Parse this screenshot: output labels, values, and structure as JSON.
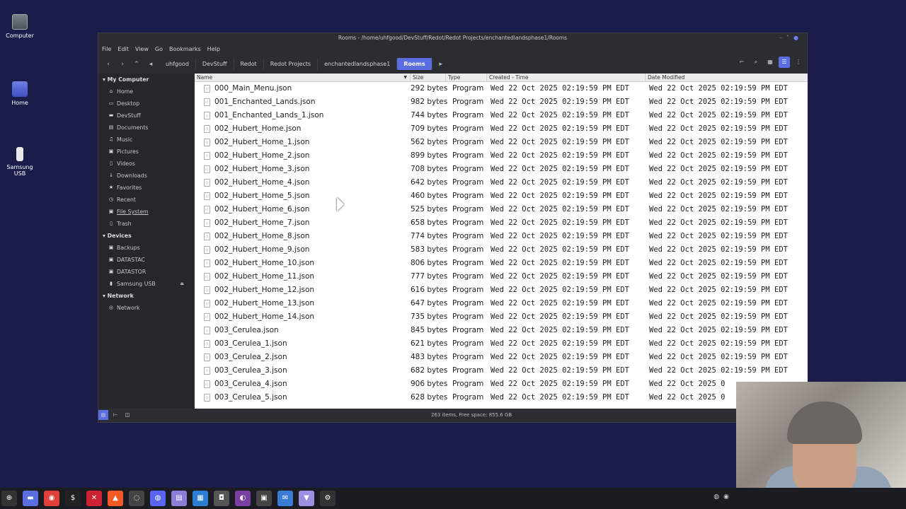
{
  "desktop": {
    "icons": [
      {
        "label": "Computer"
      },
      {
        "label": "Home"
      },
      {
        "label": "Samsung USB"
      }
    ]
  },
  "window": {
    "title": "Rooms - /home/uhfgood/DevStuff/Redot/Redot Projects/enchantedlandsphase1/Rooms",
    "menu": [
      "File",
      "Edit",
      "View",
      "Go",
      "Bookmarks",
      "Help"
    ],
    "breadcrumbs": [
      "uhfgood",
      "DevStuff",
      "Redot",
      "Redot Projects",
      "enchantedlandsphase1",
      "Rooms"
    ],
    "status": "263 items, Free space: 855.6 GB"
  },
  "sidebar": {
    "sections": [
      {
        "title": "My Computer",
        "items": [
          {
            "label": "Home",
            "icon": "home-icon"
          },
          {
            "label": "Desktop",
            "icon": "desktop-icon"
          },
          {
            "label": "DevStuff",
            "icon": "folder-icon"
          },
          {
            "label": "Documents",
            "icon": "documents-icon"
          },
          {
            "label": "Music",
            "icon": "music-icon"
          },
          {
            "label": "Pictures",
            "icon": "pictures-icon"
          },
          {
            "label": "Videos",
            "icon": "videos-icon"
          },
          {
            "label": "Downloads",
            "icon": "downloads-icon"
          },
          {
            "label": "Favorites",
            "icon": "star-icon"
          },
          {
            "label": "Recent",
            "icon": "clock-icon"
          },
          {
            "label": "File System",
            "icon": "drive-icon"
          },
          {
            "label": "Trash",
            "icon": "trash-icon"
          }
        ]
      },
      {
        "title": "Devices",
        "items": [
          {
            "label": "Backups",
            "icon": "drive-icon"
          },
          {
            "label": "DATASTAC",
            "icon": "drive-icon"
          },
          {
            "label": "DATASTOR",
            "icon": "drive-icon"
          },
          {
            "label": "Samsung USB",
            "icon": "usb-icon"
          }
        ]
      },
      {
        "title": "Network",
        "items": [
          {
            "label": "Network",
            "icon": "network-icon"
          }
        ]
      }
    ]
  },
  "columns": {
    "name": "Name",
    "size": "Size",
    "type": "Type",
    "created": "Created - Time",
    "modified": "Date Modified"
  },
  "files": [
    {
      "name": "000_Main_Menu.json",
      "size": "292 bytes",
      "type": "Program",
      "created": "Wed 22 Oct 2025 02:19:59 PM EDT",
      "modified": "Wed 22 Oct 2025 02:19:59 PM EDT"
    },
    {
      "name": "001_Enchanted_Lands.json",
      "size": "982 bytes",
      "type": "Program",
      "created": "Wed 22 Oct 2025 02:19:59 PM EDT",
      "modified": "Wed 22 Oct 2025 02:19:59 PM EDT"
    },
    {
      "name": "001_Enchanted_Lands_1.json",
      "size": "744 bytes",
      "type": "Program",
      "created": "Wed 22 Oct 2025 02:19:59 PM EDT",
      "modified": "Wed 22 Oct 2025 02:19:59 PM EDT"
    },
    {
      "name": "002_Hubert_Home.json",
      "size": "709 bytes",
      "type": "Program",
      "created": "Wed 22 Oct 2025 02:19:59 PM EDT",
      "modified": "Wed 22 Oct 2025 02:19:59 PM EDT"
    },
    {
      "name": "002_Hubert_Home_1.json",
      "size": "562 bytes",
      "type": "Program",
      "created": "Wed 22 Oct 2025 02:19:59 PM EDT",
      "modified": "Wed 22 Oct 2025 02:19:59 PM EDT"
    },
    {
      "name": "002_Hubert_Home_2.json",
      "size": "899 bytes",
      "type": "Program",
      "created": "Wed 22 Oct 2025 02:19:59 PM EDT",
      "modified": "Wed 22 Oct 2025 02:19:59 PM EDT"
    },
    {
      "name": "002_Hubert_Home_3.json",
      "size": "708 bytes",
      "type": "Program",
      "created": "Wed 22 Oct 2025 02:19:59 PM EDT",
      "modified": "Wed 22 Oct 2025 02:19:59 PM EDT"
    },
    {
      "name": "002_Hubert_Home_4.json",
      "size": "642 bytes",
      "type": "Program",
      "created": "Wed 22 Oct 2025 02:19:59 PM EDT",
      "modified": "Wed 22 Oct 2025 02:19:59 PM EDT"
    },
    {
      "name": "002_Hubert_Home_5.json",
      "size": "460 bytes",
      "type": "Program",
      "created": "Wed 22 Oct 2025 02:19:59 PM EDT",
      "modified": "Wed 22 Oct 2025 02:19:59 PM EDT"
    },
    {
      "name": "002_Hubert_Home_6.json",
      "size": "525 bytes",
      "type": "Program",
      "created": "Wed 22 Oct 2025 02:19:59 PM EDT",
      "modified": "Wed 22 Oct 2025 02:19:59 PM EDT"
    },
    {
      "name": "002_Hubert_Home_7.json",
      "size": "658 bytes",
      "type": "Program",
      "created": "Wed 22 Oct 2025 02:19:59 PM EDT",
      "modified": "Wed 22 Oct 2025 02:19:59 PM EDT"
    },
    {
      "name": "002_Hubert_Home_8.json",
      "size": "774 bytes",
      "type": "Program",
      "created": "Wed 22 Oct 2025 02:19:59 PM EDT",
      "modified": "Wed 22 Oct 2025 02:19:59 PM EDT"
    },
    {
      "name": "002_Hubert_Home_9.json",
      "size": "583 bytes",
      "type": "Program",
      "created": "Wed 22 Oct 2025 02:19:59 PM EDT",
      "modified": "Wed 22 Oct 2025 02:19:59 PM EDT"
    },
    {
      "name": "002_Hubert_Home_10.json",
      "size": "806 bytes",
      "type": "Program",
      "created": "Wed 22 Oct 2025 02:19:59 PM EDT",
      "modified": "Wed 22 Oct 2025 02:19:59 PM EDT"
    },
    {
      "name": "002_Hubert_Home_11.json",
      "size": "777 bytes",
      "type": "Program",
      "created": "Wed 22 Oct 2025 02:19:59 PM EDT",
      "modified": "Wed 22 Oct 2025 02:19:59 PM EDT"
    },
    {
      "name": "002_Hubert_Home_12.json",
      "size": "616 bytes",
      "type": "Program",
      "created": "Wed 22 Oct 2025 02:19:59 PM EDT",
      "modified": "Wed 22 Oct 2025 02:19:59 PM EDT"
    },
    {
      "name": "002_Hubert_Home_13.json",
      "size": "647 bytes",
      "type": "Program",
      "created": "Wed 22 Oct 2025 02:19:59 PM EDT",
      "modified": "Wed 22 Oct 2025 02:19:59 PM EDT"
    },
    {
      "name": "002_Hubert_Home_14.json",
      "size": "735 bytes",
      "type": "Program",
      "created": "Wed 22 Oct 2025 02:19:59 PM EDT",
      "modified": "Wed 22 Oct 2025 02:19:59 PM EDT"
    },
    {
      "name": "003_Cerulea.json",
      "size": "845 bytes",
      "type": "Program",
      "created": "Wed 22 Oct 2025 02:19:59 PM EDT",
      "modified": "Wed 22 Oct 2025 02:19:59 PM EDT"
    },
    {
      "name": "003_Cerulea_1.json",
      "size": "621 bytes",
      "type": "Program",
      "created": "Wed 22 Oct 2025 02:19:59 PM EDT",
      "modified": "Wed 22 Oct 2025 02:19:59 PM EDT"
    },
    {
      "name": "003_Cerulea_2.json",
      "size": "483 bytes",
      "type": "Program",
      "created": "Wed 22 Oct 2025 02:19:59 PM EDT",
      "modified": "Wed 22 Oct 2025 02:19:59 PM EDT"
    },
    {
      "name": "003_Cerulea_3.json",
      "size": "682 bytes",
      "type": "Program",
      "created": "Wed 22 Oct 2025 02:19:59 PM EDT",
      "modified": "Wed 22 Oct 2025 02:19:59 PM EDT"
    },
    {
      "name": "003_Cerulea_4.json",
      "size": "906 bytes",
      "type": "Program",
      "created": "Wed 22 Oct 2025 02:19:59 PM EDT",
      "modified": "Wed 22 Oct 2025 0"
    },
    {
      "name": "003_Cerulea_5.json",
      "size": "628 bytes",
      "type": "Program",
      "created": "Wed 22 Oct 2025 02:19:59 PM EDT",
      "modified": "Wed 22 Oct 2025 0"
    }
  ],
  "colors": {
    "accent": "#5b6ee1",
    "window_bg": "#2b2d33",
    "sidebar_bg": "#25272c",
    "desktop_bg": "#1a1d4a"
  },
  "taskbar": {
    "icons": [
      "menu-icon",
      "files-icon",
      "vivaldi-icon",
      "terminal-icon",
      "app-icon",
      "brave-icon",
      "chromium-icon",
      "discord-icon",
      "notes-icon",
      "editor-icon",
      "screenshot-icon",
      "github-icon",
      "calc-icon",
      "mail-icon",
      "app2-icon",
      "app3-icon"
    ]
  }
}
